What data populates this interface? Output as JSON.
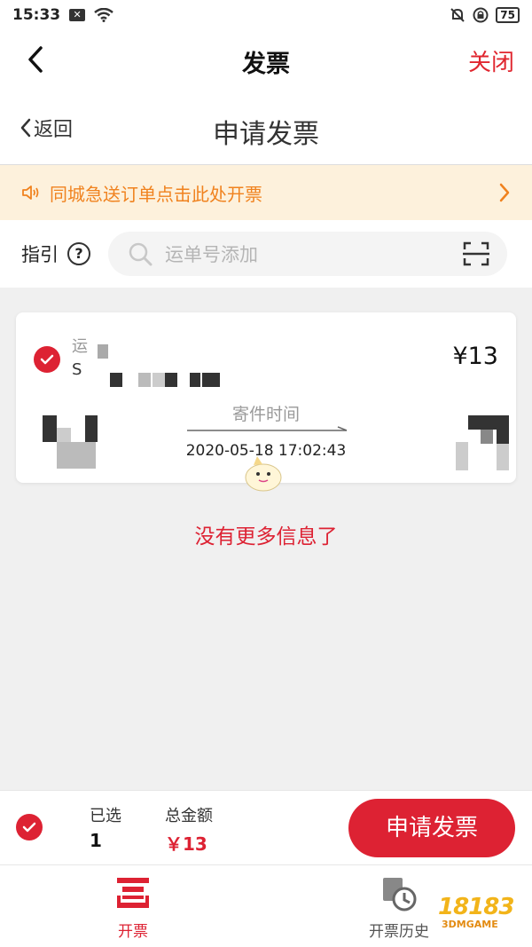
{
  "status_bar": {
    "time": "15:33",
    "battery": "75"
  },
  "nav": {
    "title": "发票",
    "close_label": "关闭"
  },
  "sub_nav": {
    "back_label": "返回",
    "title": "申请发票"
  },
  "notice": {
    "text": "同城急送订单点击此处开票"
  },
  "search": {
    "guide_label": "指引",
    "placeholder": "运单号添加"
  },
  "order_card": {
    "label_prefix": "运",
    "waybill_prefix": "S",
    "price": "¥13",
    "time_label": "寄件时间",
    "time_value": "2020-05-18 17:02:43"
  },
  "no_more_text": "没有更多信息了",
  "summary": {
    "selected_label": "已选",
    "selected_count": "1",
    "total_label": "总金额",
    "total_value": "￥13",
    "apply_button": "申请发票"
  },
  "tabs": [
    {
      "label": "开票",
      "icon": "invoice-icon"
    },
    {
      "label": "开票历史",
      "icon": "invoice-history-icon"
    }
  ],
  "watermark": {
    "number": "18183",
    "sub": "3DMGAME"
  },
  "colors": {
    "accent": "#dd2233",
    "notice_text": "#f0821e",
    "notice_bg": "#fdf1dc"
  }
}
